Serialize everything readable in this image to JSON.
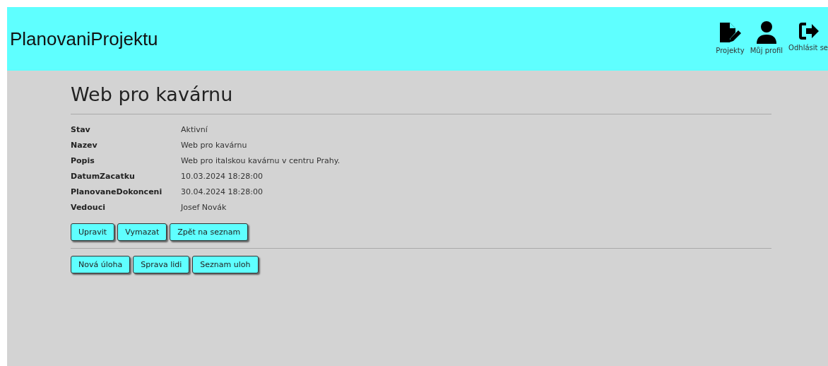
{
  "header": {
    "brand": "PlanovaniProjektu",
    "nav": [
      {
        "kind": "projects",
        "label": "Projekty"
      },
      {
        "kind": "profile",
        "label": "Můj profil"
      },
      {
        "kind": "logout",
        "label": "Odhlásit se"
      }
    ]
  },
  "page": {
    "title": "Web pro kavárnu",
    "details": [
      {
        "label": "Stav",
        "value": "Aktivní"
      },
      {
        "label": "Nazev",
        "value": "Web pro kavárnu"
      },
      {
        "label": "Popis",
        "value": "Web pro italskou kavárnu v centru Prahy."
      },
      {
        "label": "DatumZacatku",
        "value": "10.03.2024 18:28:00"
      },
      {
        "label": "PlanovaneDokonceni",
        "value": "30.04.2024 18:28:00"
      },
      {
        "label": "Vedouci",
        "value": "Josef Novák"
      }
    ],
    "actions": [
      "Upravit",
      "Vymazat",
      "Zpět na seznam"
    ],
    "tools": [
      "Nová úloha",
      "Sprava lidi",
      "Seznam uloh"
    ]
  }
}
